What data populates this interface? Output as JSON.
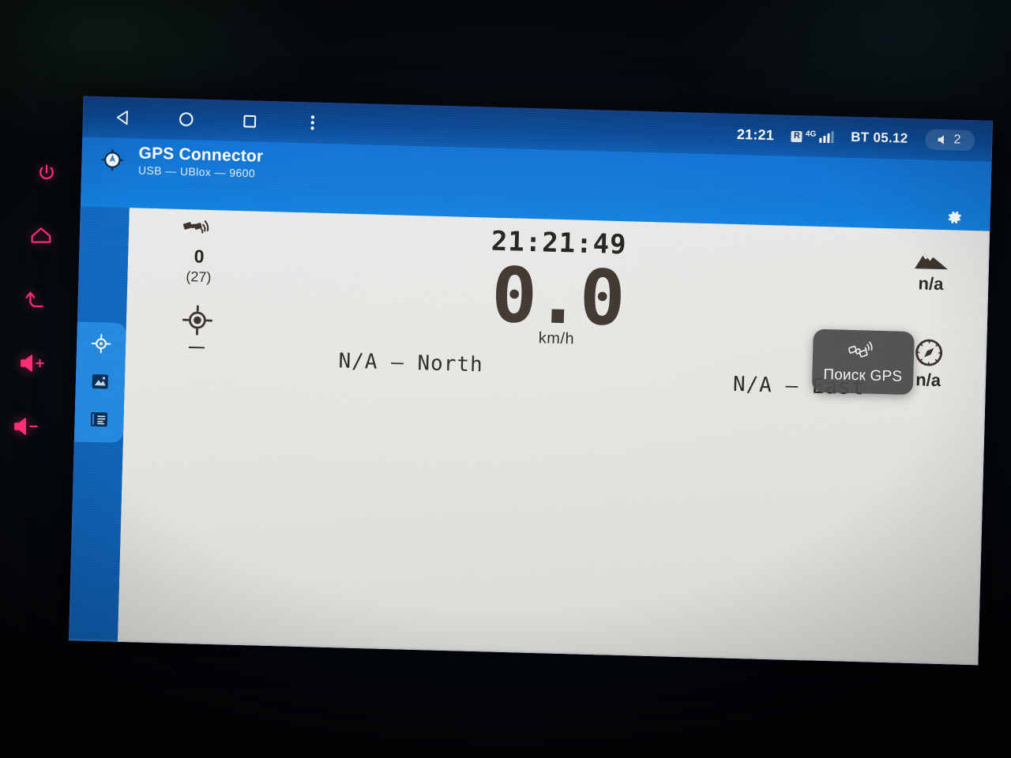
{
  "system_bar": {
    "nav": [
      {
        "name": "back",
        "icon": "triangle-left-icon"
      },
      {
        "name": "home",
        "icon": "circle-icon"
      },
      {
        "name": "recents",
        "icon": "square-icon"
      },
      {
        "name": "overflow",
        "icon": "dots-vertical-icon"
      }
    ],
    "clock": "21:21",
    "roaming_badge": "R",
    "network_gen": "4G",
    "signal_bars": 3,
    "signal_bars_total": 4,
    "bluetooth_label": "BT 05.12",
    "volume_level": "2"
  },
  "app_bar": {
    "icon": "compass-app-icon",
    "title": "GPS Connector",
    "subtitle": "USB — UBlox — 9600",
    "settings_icon": "gear-icon"
  },
  "rail": {
    "tabs": [
      {
        "name": "gps-location",
        "icon": "crosshair-icon",
        "active": true
      },
      {
        "name": "skyview-image",
        "icon": "image-icon",
        "active": false
      },
      {
        "name": "nmea-log",
        "icon": "list-document-icon",
        "active": false
      }
    ]
  },
  "dashboard": {
    "satellites": {
      "icon": "satellite-icon",
      "used": "0",
      "in_view": "(27)"
    },
    "fix": {
      "icon": "crosshair-target-icon",
      "value": "—"
    },
    "clock": "21:21:49",
    "speed": {
      "value": "0.0",
      "unit": "km/h"
    },
    "latitude": "N/A — North",
    "longitude": "N/A — East",
    "altitude": {
      "icon": "mountain-icon",
      "value": "n/a"
    },
    "bearing": {
      "icon": "compass-icon",
      "value": "n/a"
    }
  },
  "toast": {
    "icon": "satellite-search-icon",
    "text": "Поиск GPS"
  },
  "hardware_buttons": [
    {
      "name": "power",
      "icon": "power-icon"
    },
    {
      "name": "home",
      "icon": "home-icon"
    },
    {
      "name": "back",
      "icon": "back-arrow-icon"
    },
    {
      "name": "volume-up",
      "icon": "volume-up-icon"
    },
    {
      "name": "volume-down",
      "icon": "volume-down-icon"
    }
  ],
  "colors": {
    "accent_blue": "#1273d4",
    "status_blue": "#0b4a96",
    "rail_blue": "#0d5cae",
    "rail_active": "#2388de",
    "panel": "#e9e9e6",
    "hw_button": "#ff2d73",
    "toast_bg": "#484848"
  }
}
